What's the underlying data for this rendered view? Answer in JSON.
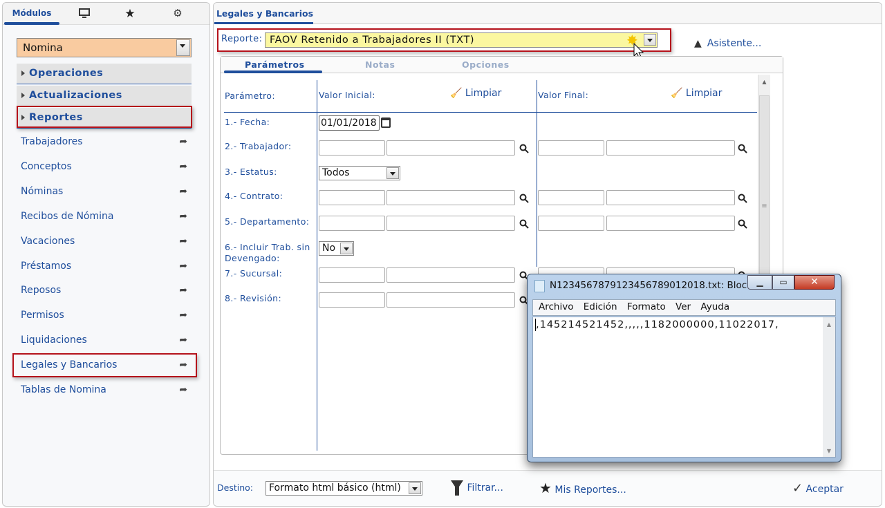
{
  "sidebar": {
    "tabs": {
      "modules": "Módulos",
      "icons": [
        "monitor-icon",
        "star-icon",
        "settings-icon"
      ]
    },
    "module_select": "Nomina",
    "sections": [
      "Operaciones",
      "Actualizaciones",
      "Reportes"
    ],
    "items": [
      "Trabajadores",
      "Conceptos",
      "Nóminas",
      "Recibos de Nómina",
      "Vacaciones",
      "Préstamos",
      "Reposos",
      "Permisos",
      "Liquidaciones",
      "Legales y Bancarios",
      "Tablas de Nomina"
    ]
  },
  "main": {
    "tab": "Legales y Bancarios",
    "report_label": "Reporte:",
    "report_value": "FAOV Retenido a Trabajadores II (TXT)",
    "wizard": "Asistente...",
    "subtabs": [
      "Parámetros",
      "Notas",
      "Opciones"
    ],
    "headers": {
      "param": "Parámetro:",
      "initial": "Valor Inicial:",
      "final": "Valor Final:",
      "clear": "Limpiar"
    },
    "params": [
      {
        "label": "1.- Fecha:",
        "value": "01/01/2018"
      },
      {
        "label": "2.- Trabajador:"
      },
      {
        "label": "3.- Estatus:",
        "value": "Todos"
      },
      {
        "label": "4.- Contrato:"
      },
      {
        "label": "5.- Departamento:"
      },
      {
        "label": "6.- Incluir Trab. sin Devengado:",
        "value": "No"
      },
      {
        "label": "7.- Sucursal:"
      },
      {
        "label": "8.- Revisión:"
      }
    ],
    "footer": {
      "dest_label": "Destino:",
      "dest_value": "Formato html básico (html)",
      "filter": "Filtrar...",
      "my_reports": "Mis Reportes...",
      "accept": "Aceptar"
    }
  },
  "notepad": {
    "title": "N123456787912345678901​2018.txt: Bloc ...",
    "menu": [
      "Archivo",
      "Edición",
      "Formato",
      "Ver",
      "Ayuda"
    ],
    "content": ",145214521452,,,,,1182000000,11022017,"
  },
  "colors": {
    "accent": "#1f4e9c",
    "highlight": "#c00000",
    "report_bg": "#fbf7a0",
    "module_bg": "#f9cba0"
  }
}
